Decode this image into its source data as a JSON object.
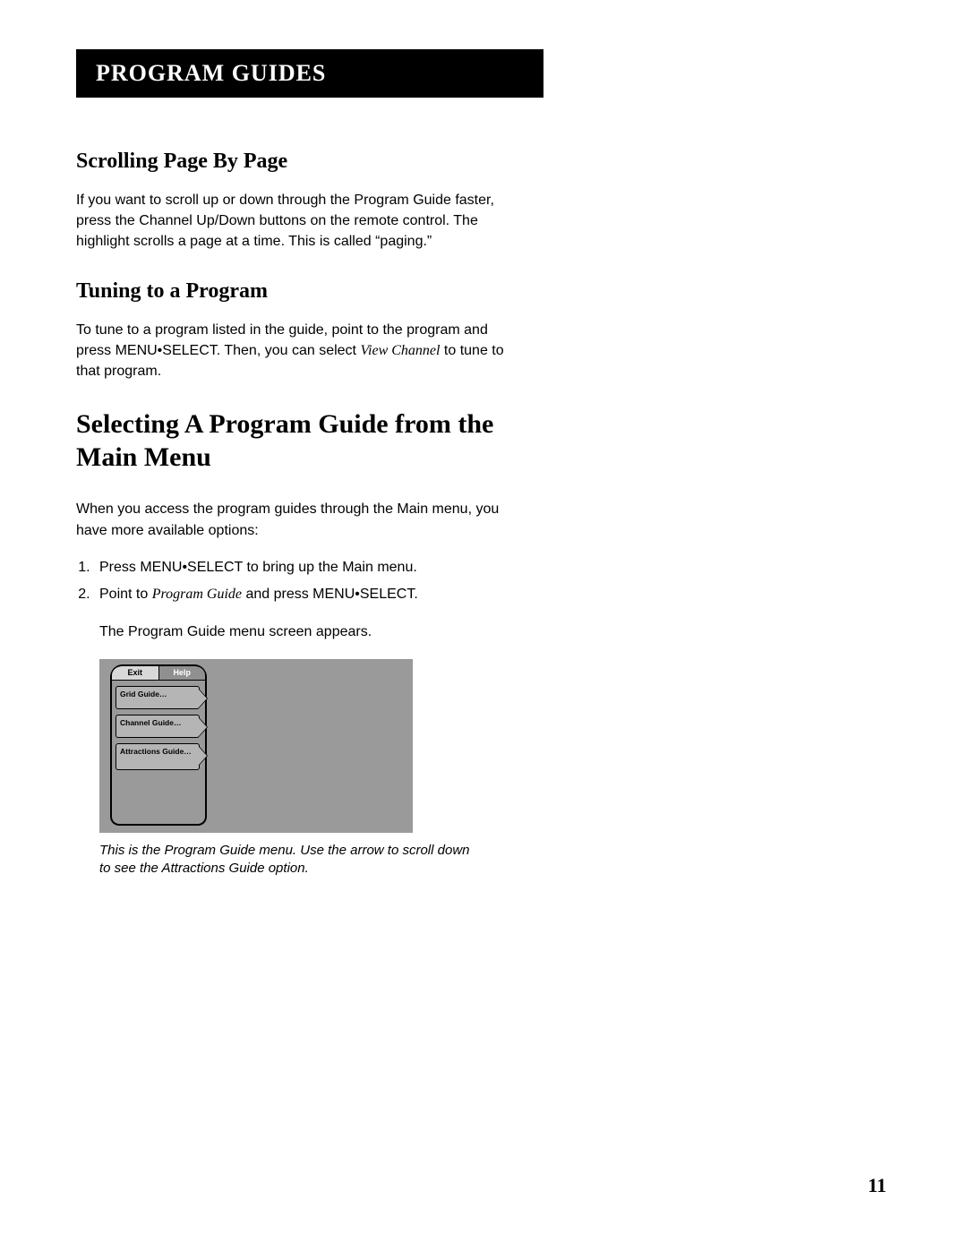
{
  "header": {
    "title": "PROGRAM GUIDES"
  },
  "section1": {
    "heading": "Scrolling Page By Page",
    "body": "If you want to scroll up or down through the Program Guide faster, press the Channel Up/Down buttons on the remote control. The highlight scrolls a page at a time. This is called “paging.”"
  },
  "section2": {
    "heading": "Tuning to a Program",
    "body_pre": "To tune to a program listed in the guide, point to the program and press MENU•SELECT. Then, you can select ",
    "body_italic": "View Channel",
    "body_post": " to tune to that program."
  },
  "section3": {
    "heading": "Selecting A Program Guide from the Main Menu",
    "intro": "When you access the program guides through the Main menu, you have more available options:",
    "step1": "Press MENU•SELECT to bring up the Main menu.",
    "step2_pre": "Point to ",
    "step2_italic": "Program Guide",
    "step2_post": " and press MENU•SELECT.",
    "step2_sub": "The Program Guide menu screen appears."
  },
  "figure": {
    "tab_exit": "Exit",
    "tab_help": "Help",
    "item1": "Grid Guide…",
    "item2": "Channel Guide…",
    "item3": "Attractions Guide…",
    "caption": "This is the Program Guide menu. Use the arrow to scroll down to see the Attractions Guide option."
  },
  "page_number": "11"
}
